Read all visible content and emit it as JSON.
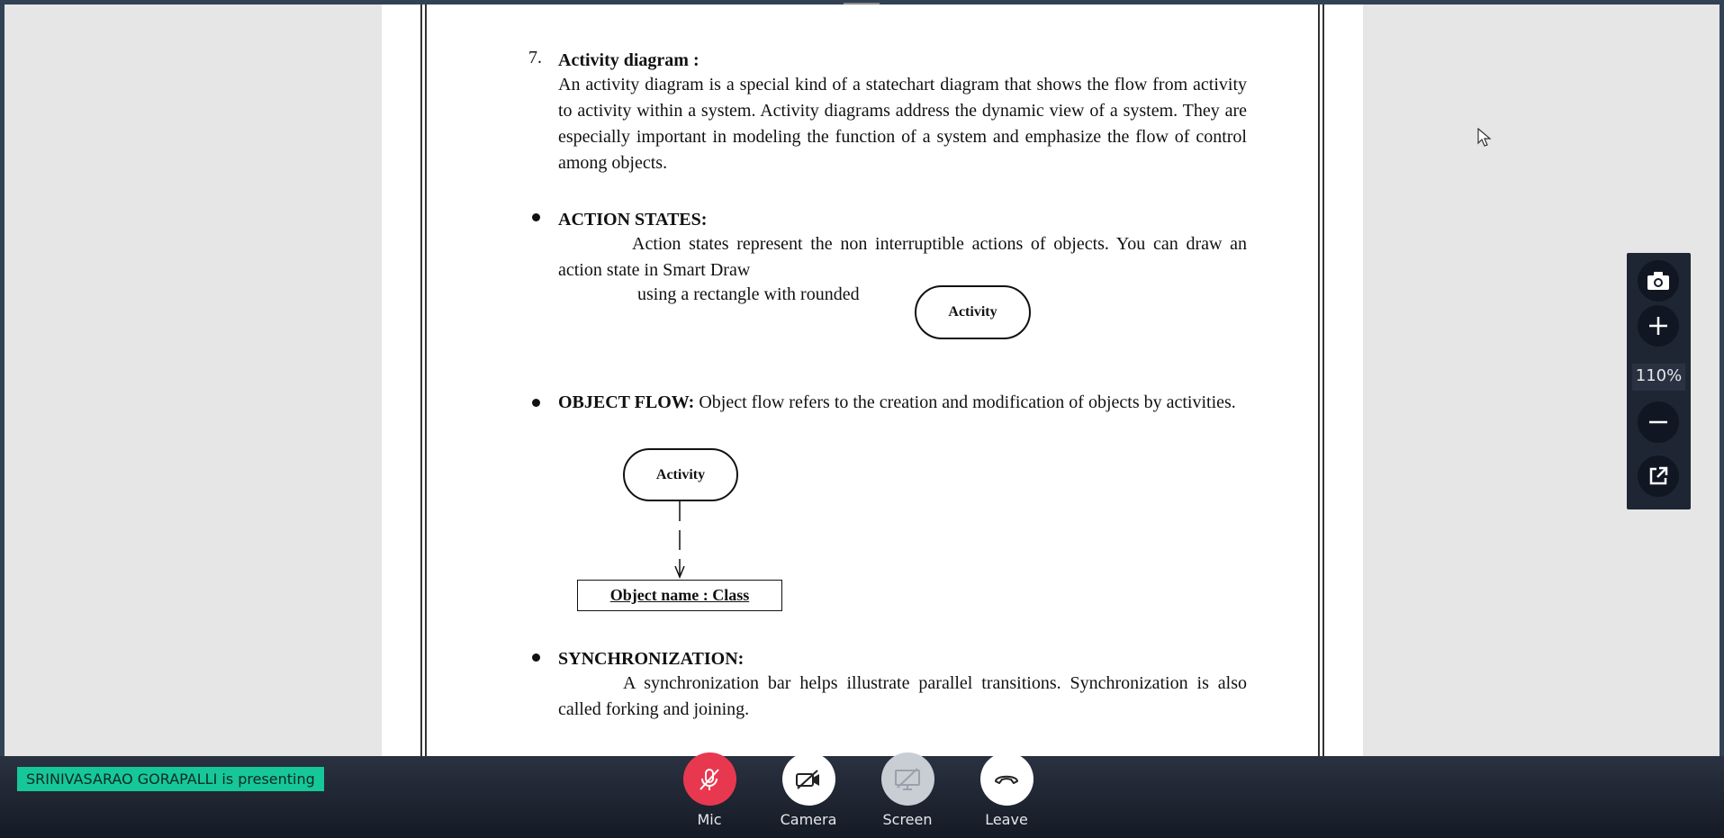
{
  "document": {
    "section7": {
      "number": "7.",
      "heading": "Activity diagram :",
      "body": "An activity diagram is a special kind of a statechart diagram that shows the flow from activity to activity within a system. Activity diagrams address the dynamic view of a system. They are especially important in modeling the function of a system and emphasize the flow of control among objects."
    },
    "action_states": {
      "heading": "ACTION STATES:",
      "body_line1": "Action states represent the non interruptible actions of objects. You can draw an action state in Smart Draw",
      "body_line2": "using   a rectangle with rounded",
      "diagram_label": "Activity"
    },
    "object_flow": {
      "heading": "OBJECT FLOW:",
      "body": " Object flow refers to the creation and modification of objects by activities.",
      "activity_label": "Activity",
      "object_label": "Object name : Class"
    },
    "synchronization": {
      "heading": "SYNCHRONIZATION:",
      "body": "A synchronization bar helps illustrate parallel transitions. Synchronization is also called forking and joining."
    }
  },
  "zoom_panel": {
    "icons": [
      "camera-icon",
      "plus-icon",
      "minus-icon",
      "external-link-icon"
    ],
    "zoom_level": "110%"
  },
  "status": {
    "presenting_text": "SRINIVASARAO GORAPALLI is presenting",
    "badge_color": "#16c79a"
  },
  "controls": {
    "mic": {
      "label": "Mic",
      "icon": "mic-off-icon",
      "color": "#e8384f"
    },
    "camera": {
      "label": "Camera",
      "icon": "camera-off-icon",
      "color": "#ffffff"
    },
    "screen": {
      "label": "Screen",
      "icon": "screen-share-icon",
      "color": "#c9cdd4"
    },
    "leave": {
      "label": "Leave",
      "icon": "phone-hangup-icon",
      "color": "#ffffff"
    }
  }
}
